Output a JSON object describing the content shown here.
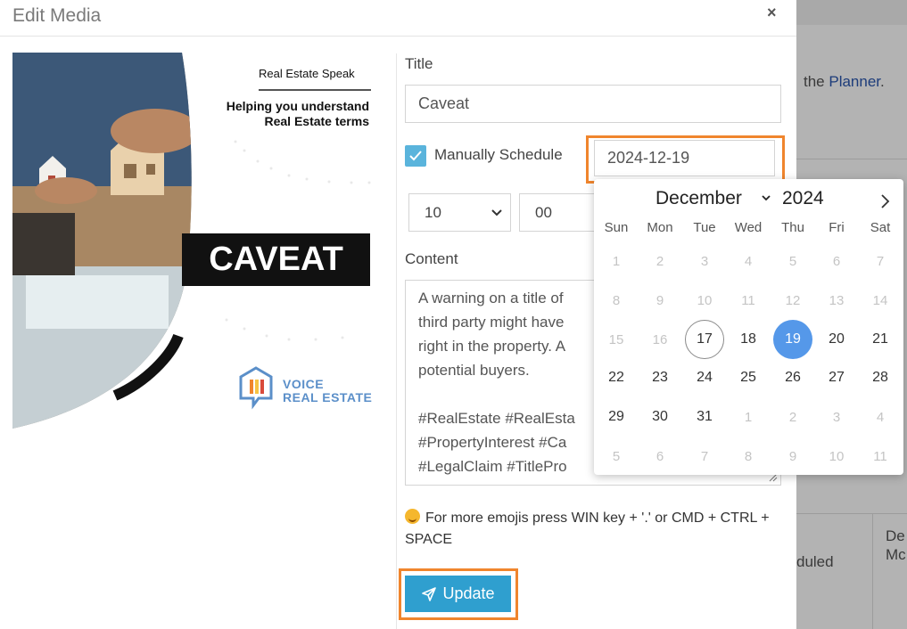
{
  "background": {
    "text_line": "the Planner.",
    "text_prefix": "the ",
    "link": "Planner",
    "text_suffix": ".",
    "status_fragment": "duled",
    "col_fragment_1": "De",
    "col_fragment_2": "Mc"
  },
  "modal": {
    "title": "Edit Media",
    "close_glyph": "×"
  },
  "media_image": {
    "series": "Real Estate Speak",
    "tagline_1": "Helping you understand",
    "tagline_2": "Real Estate terms",
    "word": "CAVEAT",
    "brand_1": "VOICE",
    "brand_2": "REAL ESTATE"
  },
  "form": {
    "title_label": "Title",
    "title_value": "Caveat",
    "manual_schedule_label": "Manually Schedule",
    "manual_schedule_checked": true,
    "date_value": "2024-12-19",
    "hour_value": "10",
    "minute_value": "00",
    "content_label": "Content",
    "content_lines": [
      "A warning on a title of",
      "third party might have",
      "right in the property. A",
      "potential buyers."
    ],
    "hashtag_lines": [
      "#RealEstate #RealEsta",
      "#PropertyInterest #Ca",
      "#LegalClaim #TitlePro"
    ],
    "emoji_hint": "For more emojis press WIN key + '.' or CMD + CTRL + SPACE",
    "update_label": "Update"
  },
  "calendar": {
    "month": "December",
    "year": "2024",
    "weekdays": [
      "Sun",
      "Mon",
      "Tue",
      "Wed",
      "Thu",
      "Fri",
      "Sat"
    ],
    "weeks": [
      [
        "1",
        "2",
        "3",
        "4",
        "5",
        "6",
        "7"
      ],
      [
        "8",
        "9",
        "10",
        "11",
        "12",
        "13",
        "14"
      ],
      [
        "15",
        "16",
        "17",
        "18",
        "19",
        "20",
        "21"
      ],
      [
        "22",
        "23",
        "24",
        "25",
        "26",
        "27",
        "28"
      ],
      [
        "29",
        "30",
        "31",
        "1",
        "2",
        "3",
        "4"
      ],
      [
        "5",
        "6",
        "7",
        "8",
        "9",
        "10",
        "11"
      ]
    ],
    "disabled_through_day": "16",
    "today": "17",
    "selected": "19"
  },
  "colors": {
    "accent_blue": "#2f9fcf",
    "selected_blue": "#5598e9",
    "highlight_orange": "#f0852d",
    "checkbox_blue": "#5ab4dc"
  }
}
